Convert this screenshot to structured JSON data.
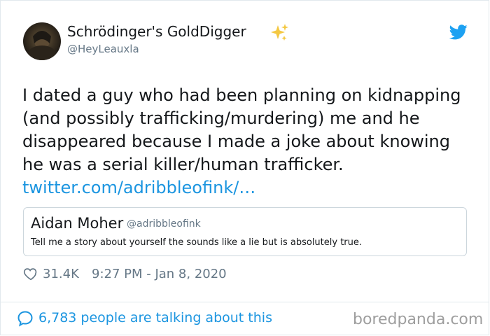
{
  "author": {
    "name": "Schrödinger's GoldDigger",
    "handle": "@HeyLeauxla",
    "avatar_icon": "profile-photo"
  },
  "tweet": {
    "text": "I dated a guy who had been planning on kidnapping (and possibly trafficking/murdering) me and he disappeared because I made a joke about knowing he was a serial killer/human trafficker.",
    "link": "twitter.com/adribbleofink/…"
  },
  "quoted_tweet": {
    "name": "Aidan Moher",
    "handle": "@adribbleofink",
    "text": "Tell me a story about yourself the sounds like a lie but is absolutely true."
  },
  "meta": {
    "likes": "31.4K",
    "timestamp": "9:27 PM - Jan 8, 2020"
  },
  "footer": {
    "talking": "6,783 people are talking about this",
    "watermark": "boredpanda.com"
  },
  "colors": {
    "link": "#1b95e0",
    "secondary_text": "#657786",
    "border": "#e1e8ed",
    "sparkle": "#f4c842"
  },
  "icons": [
    "sparkles-icon",
    "twitter-bird-icon",
    "heart-icon",
    "speech-bubble-icon"
  ]
}
